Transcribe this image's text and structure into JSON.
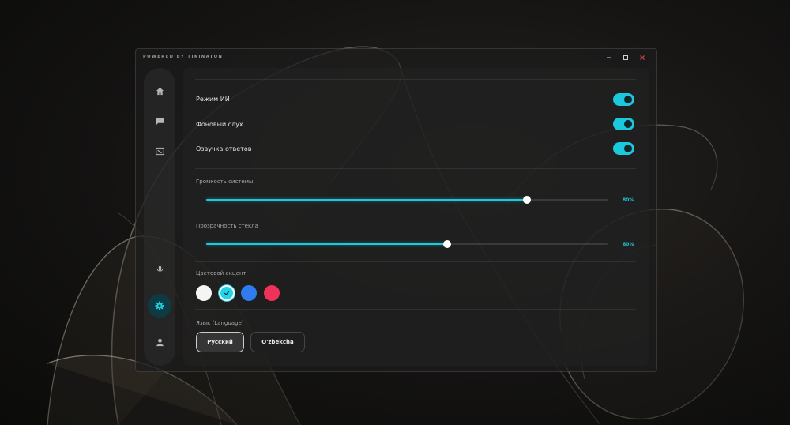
{
  "window": {
    "title": "POWERED BY TIKINATON",
    "controls": [
      "minimize-icon",
      "maximize-icon",
      "close-icon"
    ],
    "close_color": "#e04848"
  },
  "sidebar": {
    "items": [
      {
        "id": "home",
        "icon": "home-icon",
        "active": false
      },
      {
        "id": "chat",
        "icon": "chat-icon",
        "active": false
      },
      {
        "id": "terminal",
        "icon": "terminal-icon",
        "active": false
      },
      {
        "id": "mic",
        "icon": "microphone-icon",
        "active": false
      },
      {
        "id": "settings",
        "icon": "gear-icon",
        "active": true
      },
      {
        "id": "profile",
        "icon": "user-icon",
        "active": false
      }
    ],
    "active_color": "#1ec8dc"
  },
  "settings": {
    "toggles": [
      {
        "label": "Режим ИИ",
        "on": true
      },
      {
        "label": "Фоновый слух",
        "on": true
      },
      {
        "label": "Озвучка ответов",
        "on": true
      }
    ],
    "volume": {
      "label": "Громкость системы",
      "value": 0.8,
      "display": "80%"
    },
    "transparency": {
      "label": "Прозрачность стекла",
      "value": 0.6,
      "display": "60%"
    },
    "accent": {
      "label": "Цветовой акцент",
      "colors": [
        {
          "name": "white",
          "hex": "#f5f5f5",
          "selected": false
        },
        {
          "name": "cyan",
          "hex": "#22d6ea",
          "selected": true
        },
        {
          "name": "blue",
          "hex": "#2f7bf0",
          "selected": false
        },
        {
          "name": "red",
          "hex": "#f0325a",
          "selected": false
        }
      ]
    },
    "language": {
      "label": "Язык (Language)",
      "options": [
        {
          "label": "Русский",
          "selected": true
        },
        {
          "label": "O'zbekcha",
          "selected": false
        }
      ]
    }
  },
  "accent_color": "#1ec8dc"
}
